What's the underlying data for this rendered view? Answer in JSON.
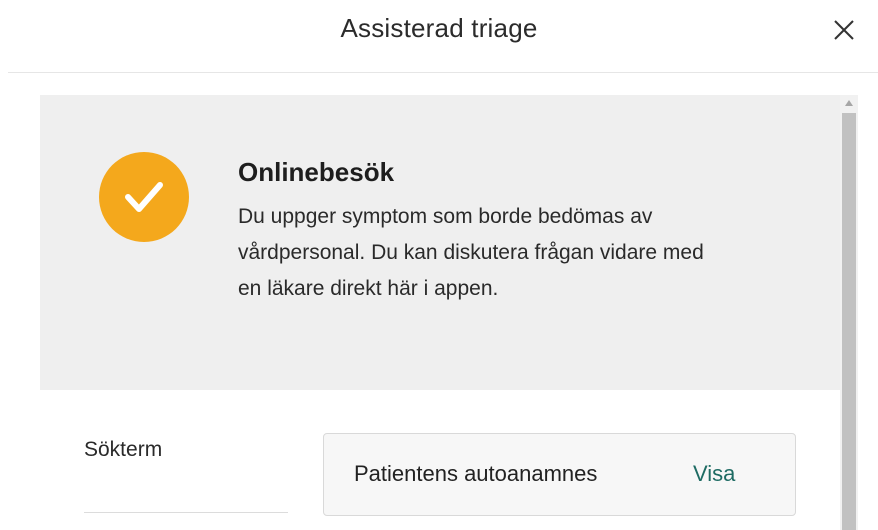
{
  "header": {
    "title": "Assisterad triage",
    "close_icon": "close-icon"
  },
  "result": {
    "icon": "checkmark-icon",
    "badge_color": "#f4a81c",
    "title": "Onlinebesök",
    "body_lines": [
      "Du uppger symptom som borde bedömas av",
      "vårdpersonal. Du kan diskutera frågan vidare med",
      "en läkare direkt här i appen."
    ]
  },
  "details": {
    "sokterm_label": "Sökterm",
    "anamnes_label": "Patientens autoanamnes",
    "anamnes_link": "Visa",
    "link_color": "#1e6b63"
  }
}
